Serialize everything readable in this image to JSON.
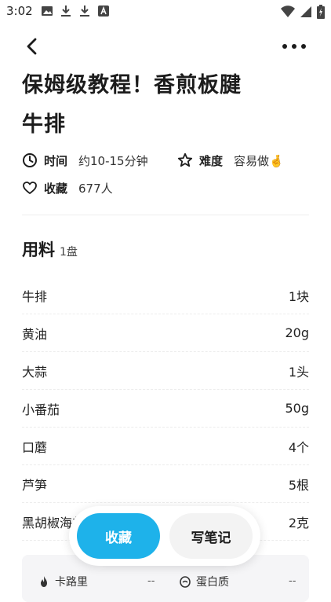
{
  "status_bar": {
    "time": "3:02",
    "left_icons": [
      "image-icon",
      "download-icon",
      "download-icon",
      "a-icon"
    ],
    "right_icons": [
      "wifi-icon",
      "signal-icon",
      "battery-charging-icon"
    ]
  },
  "top_bar": {
    "back_icon": "chevron-left-icon",
    "more_icon": "more-horizontal-icon"
  },
  "recipe": {
    "title_line1": "保姆级教程！香煎板腱",
    "title_line2": "牛排",
    "time_label": "时间",
    "time_value": "约10-15分钟",
    "difficulty_label": "难度",
    "difficulty_value": "容易做🤞",
    "favorites_label": "收藏",
    "favorites_value": "677人"
  },
  "ingredients": {
    "title": "用料",
    "serving": "1盘",
    "items": [
      {
        "name": "牛排",
        "amount": "1块"
      },
      {
        "name": "黄油",
        "amount": "20g"
      },
      {
        "name": "大蒜",
        "amount": "1头"
      },
      {
        "name": "小番茄",
        "amount": "50g"
      },
      {
        "name": "口蘑",
        "amount": "4个"
      },
      {
        "name": "芦笋",
        "amount": "5根"
      },
      {
        "name": "黑胡椒海盐",
        "amount": "2克"
      }
    ]
  },
  "nutrition": {
    "calories_label": "卡路里",
    "calories_value": "--",
    "protein_label": "蛋白质",
    "protein_value": "--"
  },
  "actions": {
    "favorite_label": "收藏",
    "note_label": "写笔记"
  },
  "colors": {
    "accent": "#1eb2ea",
    "note_bg": "#f3f3f3",
    "calorie_icon": "#333333"
  }
}
